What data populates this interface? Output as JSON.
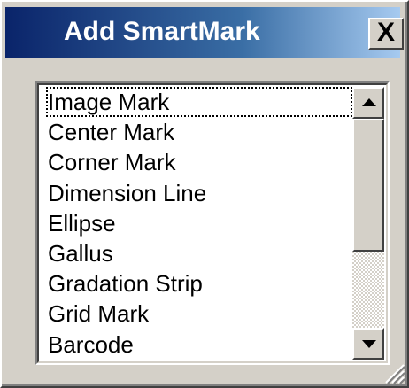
{
  "dialog": {
    "title": "Add SmartMark",
    "close_label": "X"
  },
  "list": {
    "items": [
      {
        "label": "Image Mark",
        "focused": true
      },
      {
        "label": "Center Mark"
      },
      {
        "label": "Corner Mark"
      },
      {
        "label": "Dimension Line"
      },
      {
        "label": "Ellipse"
      },
      {
        "label": "Gallus"
      },
      {
        "label": "Gradation Strip"
      },
      {
        "label": "Grid Mark"
      },
      {
        "label": "Barcode"
      }
    ],
    "scroll_position": 0
  },
  "icons": {
    "close": "close-icon",
    "scroll_up": "scroll-up-arrow-icon",
    "scroll_down": "scroll-down-arrow-icon",
    "resize_grip": "resize-grip-icon"
  },
  "colors": {
    "title_gradient_start": "#0a246a",
    "title_gradient_end": "#a6caf0",
    "face": "#d4d0c8",
    "list_background": "#ffffff"
  }
}
